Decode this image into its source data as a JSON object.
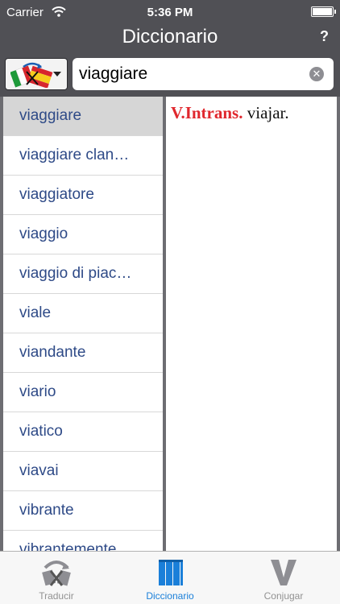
{
  "status": {
    "carrier": "Carrier",
    "time": "5:36 PM"
  },
  "nav": {
    "title": "Diccionario",
    "help": "?"
  },
  "search": {
    "value": "viaggiare"
  },
  "word_list": [
    "viaggiare",
    "viaggiare clan…",
    "viaggiatore",
    "viaggio",
    "viaggio di piac…",
    "viale",
    "viandante",
    "viario",
    "viatico",
    "viavai",
    "vibrante",
    "vibrantemente"
  ],
  "selected_index": 0,
  "definition": {
    "pos": "V.Intrans.",
    "translation": "viajar."
  },
  "tabs": [
    {
      "label": "Traducir",
      "icon": "translate-icon"
    },
    {
      "label": "Diccionario",
      "icon": "books-icon"
    },
    {
      "label": "Conjugar",
      "icon": "v-letter-icon"
    }
  ],
  "colors": {
    "bar": "#505055",
    "link_blue": "#2e4a87",
    "pos_red": "#e0282e",
    "tab_active": "#1a7fd9",
    "tab_inactive": "#929292"
  }
}
